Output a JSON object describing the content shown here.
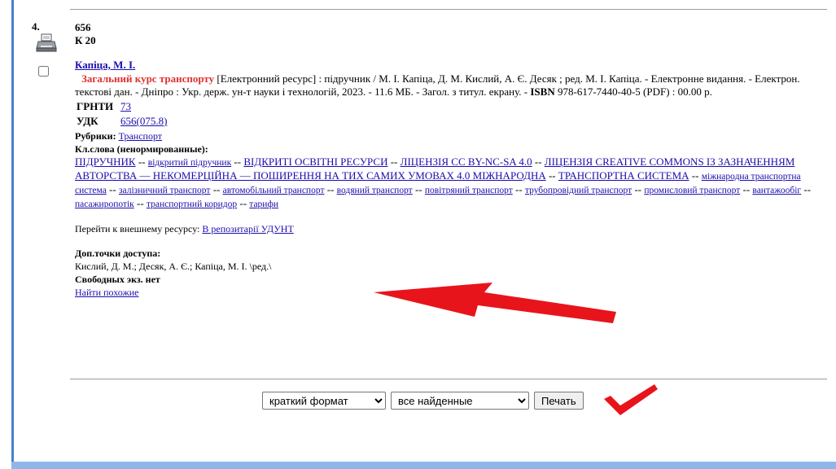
{
  "record": {
    "number": "4.",
    "class_code": "656",
    "author_mark": "К 20",
    "author": "Капіца, М. І.",
    "title_bold": "Загальний курс транспорту",
    "description": " [Електронний ресурс] : підручник / М. І. Капіца, Д. М. Кислий, А. Є. Десяк ; ред. М. І. Капіца. - Електронне видання. - Електрон. текстові дан. - Дніпро : Укр. держ. ун-т науки і технологій, 2023. - 11.6 МБ. - Загол. з титул. екрану. - ",
    "isbn_label": "ISBN",
    "isbn_value": " 978-617-7440-40-5 (PDF) : 00.00 р.",
    "grnti_label": "ГРНТИ",
    "grnti_value": "73",
    "udk_label": "УДК",
    "udk_value": "656(075.8)",
    "rubrics_label": "Рубрики:",
    "rubrics_value": "Транспорт",
    "keywords_label": "Кл.слова (ненормированные):",
    "keywords": [
      {
        "text": "ПІДРУЧНИК",
        "small": false
      },
      {
        "text": "відкритий підручник",
        "small": true
      },
      {
        "text": "ВІДКРИТІ ОСВІТНІ РЕСУРСИ",
        "small": false
      },
      {
        "text": "ЛІЦЕНЗІЯ CC BY-NC-SA 4.0",
        "small": false
      },
      {
        "text": "ЛІЦЕНЗІЯ CREATIVE COMMONS ІЗ ЗАЗНАЧЕННЯМ АВТОРСТВА — НЕКОМЕРЦІЙНА — ПОШИРЕННЯ НА ТИХ САМИХ УМОВАХ 4.0 МІЖНАРОДНА",
        "small": false
      },
      {
        "text": "ТРАНСПОРТНА СИСТЕМА",
        "small": false
      },
      {
        "text": "міжнародна транспортна система",
        "small": true
      },
      {
        "text": "залізничний транспорт",
        "small": true
      },
      {
        "text": "автомобільний транспорт",
        "small": true
      },
      {
        "text": "водяний транспорт",
        "small": true
      },
      {
        "text": "повітряний транспорт",
        "small": true
      },
      {
        "text": "трубопровідний транспорт",
        "small": true
      },
      {
        "text": "промисловий транспорт",
        "small": true
      },
      {
        "text": "вантажообіг",
        "small": true
      },
      {
        "text": "пасажиропотік",
        "small": true
      },
      {
        "text": "транспортний коридор",
        "small": true
      },
      {
        "text": "тарифи",
        "small": true
      }
    ],
    "keyword_separator": " -- ",
    "external_label": "Перейти к внешнему ресурсу: ",
    "external_link": "В репозитарії УДУНТ",
    "access_label": "Доп.точки доступа:",
    "access_value": "Кислий, Д. М.; Десяк, А. Є.; Капіца, М. І. \\ред.\\",
    "copies": "Свободных экз. нет",
    "find_similar": "Найти похожие"
  },
  "controls": {
    "format_selected": "краткий формат",
    "scope_selected": "все найденные",
    "print_label": "Печать"
  },
  "colors": {
    "title_red": "#e03030",
    "link_blue": "#1a0dab",
    "annotation_red": "#e8141b",
    "frame_blue": "#4a7fd4"
  },
  "icons": {
    "printer": "printer-icon",
    "arrow": "red-arrow-annotation",
    "check": "red-checkmark-annotation"
  }
}
